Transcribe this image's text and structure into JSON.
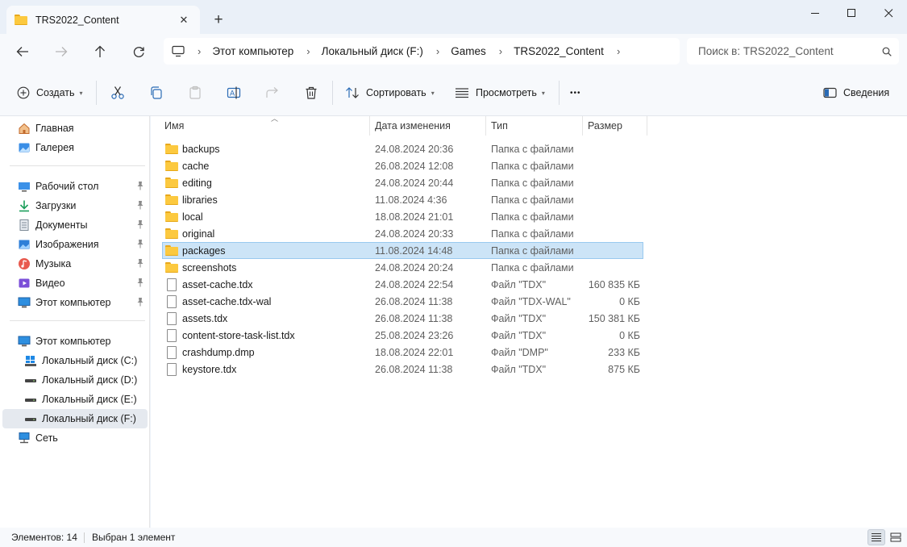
{
  "window": {
    "tab_title": "TRS2022_Content",
    "new_tab_label": "+"
  },
  "address": {
    "crumbs": [
      "Этот компьютер",
      "Локальный диск (F:)",
      "Games",
      "TRS2022_Content"
    ]
  },
  "search": {
    "placeholder": "Поиск в: TRS2022_Content"
  },
  "toolbar": {
    "create_label": "Создать",
    "sort_label": "Сортировать",
    "view_label": "Просмотреть",
    "details_label": "Сведения",
    "more_label": "•••"
  },
  "sidebar": {
    "items": [
      {
        "label": "Главная",
        "icon": "home-icon"
      },
      {
        "label": "Галерея",
        "icon": "gallery-icon"
      },
      {
        "label": "Рабочий стол",
        "icon": "desktop-icon",
        "pinned": true
      },
      {
        "label": "Загрузки",
        "icon": "downloads-icon",
        "pinned": true
      },
      {
        "label": "Документы",
        "icon": "documents-icon",
        "pinned": true
      },
      {
        "label": "Изображения",
        "icon": "pictures-icon",
        "pinned": true
      },
      {
        "label": "Музыка",
        "icon": "music-icon",
        "pinned": true
      },
      {
        "label": "Видео",
        "icon": "videos-icon",
        "pinned": true
      },
      {
        "label": "Этот компьютер",
        "icon": "computer-icon",
        "pinned": true
      },
      {
        "label": "Этот компьютер",
        "icon": "computer-icon"
      },
      {
        "label": "Локальный диск (C:)",
        "icon": "windows-drive-icon"
      },
      {
        "label": "Локальный диск (D:)",
        "icon": "drive-icon"
      },
      {
        "label": "Локальный диск (E:)",
        "icon": "drive-icon"
      },
      {
        "label": "Локальный диск (F:)",
        "icon": "drive-icon",
        "selected": true
      },
      {
        "label": "Сеть",
        "icon": "network-icon"
      }
    ]
  },
  "columns": {
    "name": "Имя",
    "date": "Дата изменения",
    "type": "Тип",
    "size": "Размер"
  },
  "files": [
    {
      "name": "backups",
      "date": "24.08.2024 20:36",
      "type": "Папка с файлами",
      "size": "",
      "kind": "folder"
    },
    {
      "name": "cache",
      "date": "26.08.2024 12:08",
      "type": "Папка с файлами",
      "size": "",
      "kind": "folder"
    },
    {
      "name": "editing",
      "date": "24.08.2024 20:44",
      "type": "Папка с файлами",
      "size": "",
      "kind": "folder"
    },
    {
      "name": "libraries",
      "date": "11.08.2024 4:36",
      "type": "Папка с файлами",
      "size": "",
      "kind": "folder"
    },
    {
      "name": "local",
      "date": "18.08.2024 21:01",
      "type": "Папка с файлами",
      "size": "",
      "kind": "folder"
    },
    {
      "name": "original",
      "date": "24.08.2024 20:33",
      "type": "Папка с файлами",
      "size": "",
      "kind": "folder"
    },
    {
      "name": "packages",
      "date": "11.08.2024 14:48",
      "type": "Папка с файлами",
      "size": "",
      "kind": "folder",
      "selected": true
    },
    {
      "name": "screenshots",
      "date": "24.08.2024 20:24",
      "type": "Папка с файлами",
      "size": "",
      "kind": "folder"
    },
    {
      "name": "asset-cache.tdx",
      "date": "24.08.2024 22:54",
      "type": "Файл \"TDX\"",
      "size": "160 835 КБ",
      "kind": "file"
    },
    {
      "name": "asset-cache.tdx-wal",
      "date": "26.08.2024 11:38",
      "type": "Файл \"TDX-WAL\"",
      "size": "0 КБ",
      "kind": "file"
    },
    {
      "name": "assets.tdx",
      "date": "26.08.2024 11:38",
      "type": "Файл \"TDX\"",
      "size": "150 381 КБ",
      "kind": "file"
    },
    {
      "name": "content-store-task-list.tdx",
      "date": "25.08.2024 23:26",
      "type": "Файл \"TDX\"",
      "size": "0 КБ",
      "kind": "file"
    },
    {
      "name": "crashdump.dmp",
      "date": "18.08.2024 22:01",
      "type": "Файл \"DMP\"",
      "size": "233 КБ",
      "kind": "file"
    },
    {
      "name": "keystore.tdx",
      "date": "26.08.2024 11:38",
      "type": "Файл \"TDX\"",
      "size": "875 КБ",
      "kind": "file"
    }
  ],
  "status": {
    "count": "Элементов: 14",
    "selection": "Выбран 1 элемент"
  },
  "colors": {
    "selection_bg": "#cce4f7",
    "selection_border": "#99c9ef",
    "folder": "#fcc93f",
    "accent": "#0067c0"
  }
}
